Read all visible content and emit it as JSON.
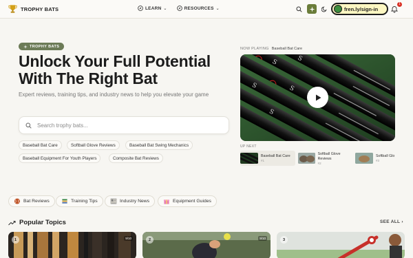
{
  "nav": {
    "brand": "TROPHY BATS",
    "menu": [
      {
        "label": "LEARN"
      },
      {
        "label": "RESOURCES"
      }
    ],
    "signin_label": "fren.ly/sign-in",
    "notification_count": "1"
  },
  "hero": {
    "pill": "TROPHY BATS",
    "title": "Unlock Your Full Potential With The Right Bat",
    "subtitle": "Expert reviews, training tips, and industry news to help you elevate your game",
    "search_placeholder": "Search trophy bats...",
    "chips": [
      "Baseball Bat Care",
      "Softball Glove Reviews",
      "Baseball Bat Swing Mechanics",
      "Baseball Equipment For Youth Players",
      "Composite Bat Reviews"
    ]
  },
  "video": {
    "now_playing_label": "NOW PLAYING",
    "now_playing_title": "Baseball Bat Care",
    "up_next_label": "UP NEXT",
    "queue": [
      {
        "title": "Baseball Bat Care",
        "num": "#1"
      },
      {
        "title": "Softball Glove Reviews",
        "num": "#2"
      },
      {
        "title": "Softball Glo",
        "num": "#3"
      }
    ]
  },
  "categories": [
    {
      "label": "Bat Reviews",
      "icon": "baseball-icon"
    },
    {
      "label": "Training Tips",
      "icon": "book-icon"
    },
    {
      "label": "Industry News",
      "icon": "newspaper-icon"
    },
    {
      "label": "Equipment Guides",
      "icon": "gift-icon"
    }
  ],
  "popular": {
    "title": "Popular Topics",
    "see_all": "SEE ALL",
    "cards": [
      {
        "num": "1",
        "score": "9/10"
      },
      {
        "num": "2",
        "score": "9/10"
      },
      {
        "num": "3",
        "score": ""
      }
    ]
  },
  "colors": {
    "accent": "#6c7b57",
    "signin_bg": "#fdf7c2",
    "badge": "#d93025"
  }
}
